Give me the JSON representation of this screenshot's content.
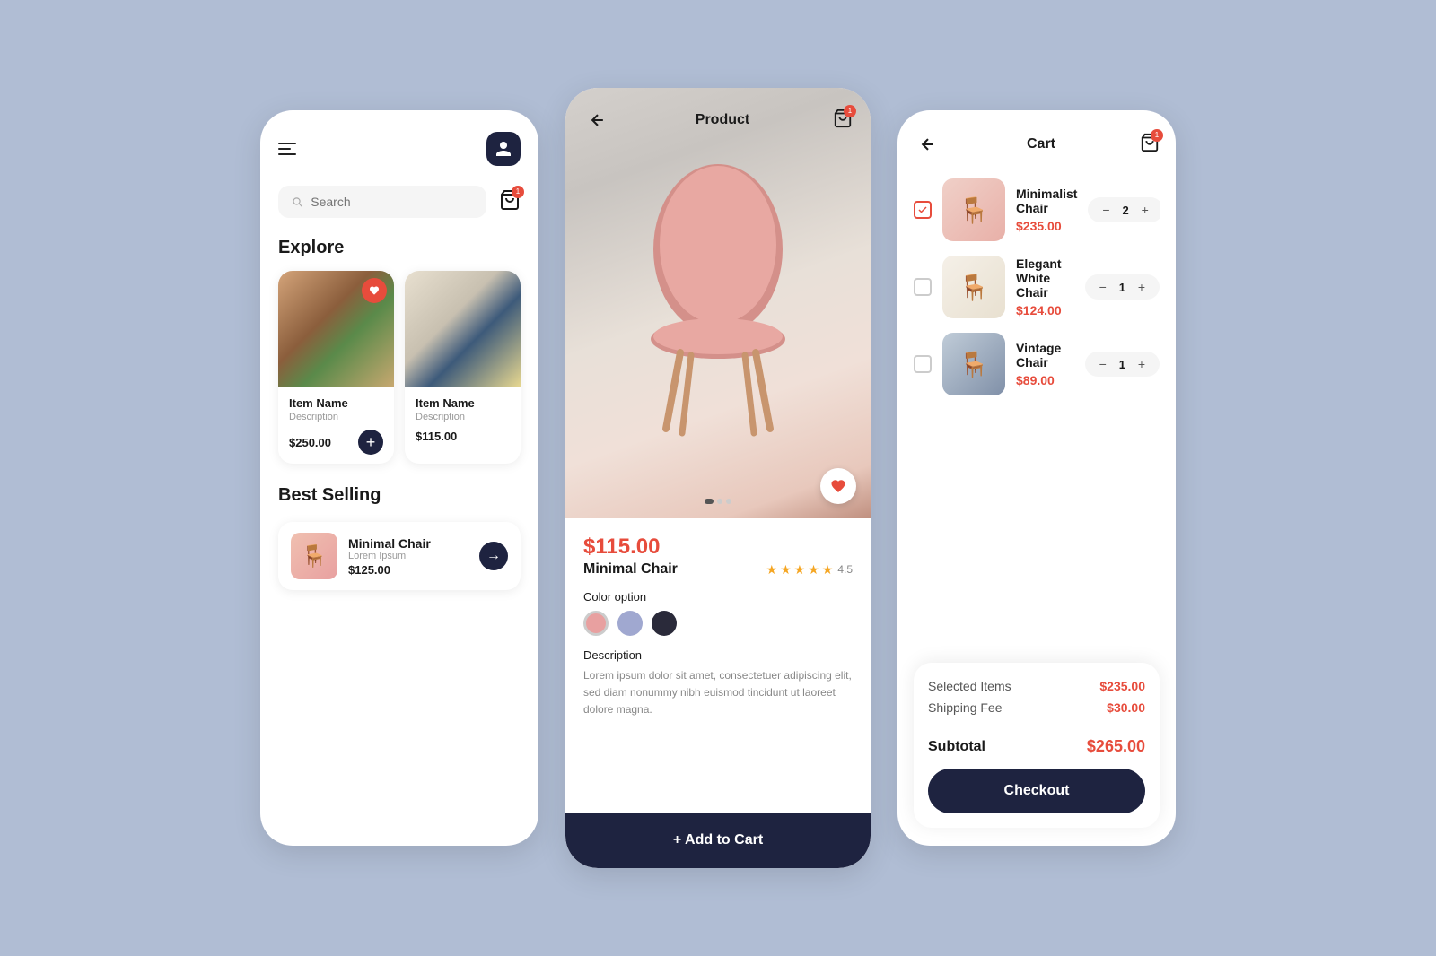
{
  "background": "#b0bdd4",
  "screen1": {
    "title": "Explore",
    "bestSelling": "Best Selling",
    "searchPlaceholder": "Search",
    "products": [
      {
        "name": "Item Name",
        "description": "Description",
        "price": "$250.00",
        "favorited": true
      },
      {
        "name": "Item Name",
        "description": "Description",
        "price": "$115.00",
        "favorited": false
      }
    ],
    "bestSellingItem": {
      "name": "Minimal Chair",
      "sub": "Lorem Ipsum",
      "price": "$125.00"
    }
  },
  "screen2": {
    "title": "Product",
    "price": "$115.00",
    "productName": "Minimal Chair",
    "rating": "4.5",
    "colorLabel": "Color option",
    "descriptionLabel": "Description",
    "descriptionText": "Lorem ipsum dolor sit amet, consectetuer adipiscing elit, sed diam nonummy nibh euismod tincidunt ut laoreet dolore magna.",
    "addToCartLabel": "+ Add to Cart"
  },
  "screen3": {
    "title": "Cart",
    "items": [
      {
        "name": "Minimalist Chair",
        "price": "$235.00",
        "qty": 2,
        "checked": true
      },
      {
        "name": "Elegant White Chair",
        "price": "$124.00",
        "qty": 1,
        "checked": false
      },
      {
        "name": "Vintage Chair",
        "price": "$89.00",
        "qty": 1,
        "checked": false
      }
    ],
    "selectedItemsLabel": "Selected Items",
    "selectedItemsValue": "$235.00",
    "shippingFeeLabel": "Shipping Fee",
    "shippingFeeValue": "$30.00",
    "subtotalLabel": "Subtotal",
    "subtotalValue": "$265.00",
    "checkoutLabel": "Checkout"
  }
}
